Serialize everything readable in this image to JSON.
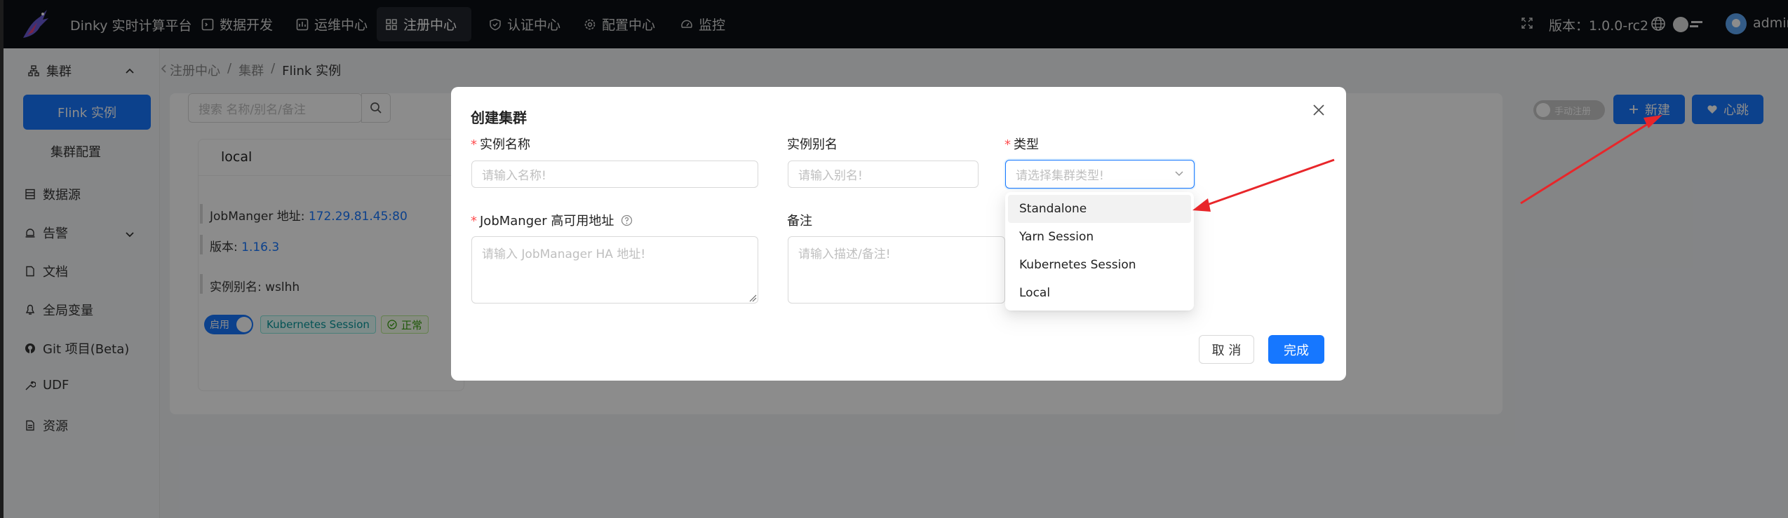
{
  "topbar": {
    "app_title": "Dinky 实时计算平台",
    "nav": [
      {
        "label": "数据开发",
        "icon": "code-icon"
      },
      {
        "label": "运维中心",
        "icon": "dashboard-icon"
      },
      {
        "label": "注册中心",
        "icon": "grid-icon",
        "active": true
      },
      {
        "label": "认证中心",
        "icon": "shield-icon"
      },
      {
        "label": "配置中心",
        "icon": "gear-icon"
      },
      {
        "label": "监控",
        "icon": "gauge-icon"
      }
    ],
    "version_label": "版本：1.0.0-rc2",
    "user_name": "admin"
  },
  "sidebar": {
    "group_label": "集群",
    "items": [
      {
        "label": "Flink 实例",
        "active": true
      },
      {
        "label": "集群配置"
      },
      {
        "label": "数据源",
        "icon": "database-icon"
      },
      {
        "label": "告警",
        "icon": "alert-icon"
      },
      {
        "label": "文档",
        "icon": "doc-icon"
      },
      {
        "label": "全局变量",
        "icon": "variable-icon"
      },
      {
        "label": "Git 项目(Beta)",
        "icon": "github-icon"
      },
      {
        "label": "UDF",
        "icon": "tool-icon"
      },
      {
        "label": "资源",
        "icon": "file-icon"
      }
    ]
  },
  "main": {
    "breadcrumb": [
      "注册中心",
      "集群",
      "Flink 实例"
    ],
    "search_placeholder": "搜索 名称/别名/备注",
    "manual_register_label": "手动注册",
    "new_button_label": "新建",
    "heartbeat_button_label": "心跳",
    "card": {
      "title": "local",
      "jobmanager_label": "JobManger 地址: ",
      "jobmanager_value": "172.29.81.45:80",
      "version_label": "版本: ",
      "version_value": "1.16.3",
      "alias_label": "实例别名: wslhh",
      "switch_label": "启用",
      "type_tag": "Kubernetes Session",
      "status_tag": "正常"
    }
  },
  "modal": {
    "title": "创建集群",
    "name_label": "实例名称",
    "name_placeholder": "请输入名称!",
    "alias_label": "实例别名",
    "alias_placeholder": "请输入别名!",
    "type_label": "类型",
    "type_placeholder": "请选择集群类型!",
    "ha_label": "JobManger 高可用地址",
    "ha_placeholder": "请输入 JobManager HA 地址!",
    "note_label": "备注",
    "note_placeholder": "请输入描述/备注!",
    "cancel_label": "取 消",
    "ok_label": "完成",
    "type_options": [
      "Standalone",
      "Yarn Session",
      "Kubernetes Session",
      "Local"
    ]
  },
  "colors": {
    "primary": "#1677ff",
    "arrow": "#e8262a",
    "topbar": "#0c1014"
  }
}
